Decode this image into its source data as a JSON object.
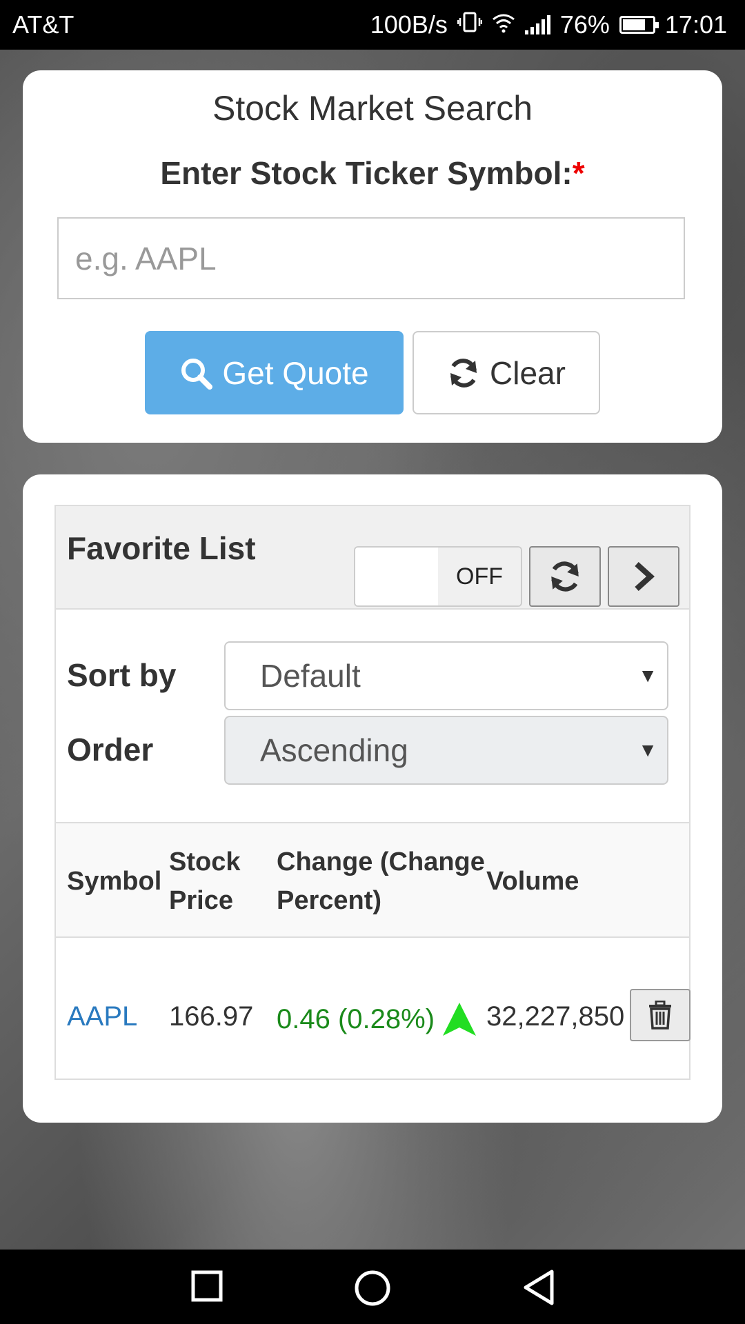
{
  "status_bar": {
    "carrier": "AT&T",
    "speed": "100B/s",
    "battery": "76%",
    "battery_level": 0.76,
    "time": "17:01"
  },
  "search_card": {
    "title": "Stock Market Search",
    "label": "Enter Stock Ticker Symbol:",
    "required_mark": "*",
    "input_value": "",
    "input_placeholder": "e.g. AAPL",
    "get_quote_label": "Get Quote",
    "clear_label": "Clear",
    "accent_color": "#5dade7"
  },
  "favorites": {
    "title": "Favorite List",
    "autorefresh_state": "OFF",
    "sort_label": "Sort by",
    "sort_value": "Default",
    "order_label": "Order",
    "order_value": "Ascending",
    "columns": {
      "symbol": "Symbol",
      "price_line1": "Stock",
      "price_line2": "Price",
      "change_line1": "Change (Change",
      "change_line2": "Percent)",
      "volume": "Volume"
    },
    "rows": [
      {
        "symbol": "AAPL",
        "price": "166.97",
        "change": "0.46 (0.28%)",
        "trend": "up-arrow-icon",
        "volume": "32,227,850"
      }
    ],
    "positive_color": "#1a8a1a",
    "link_color": "#2a7abf"
  }
}
